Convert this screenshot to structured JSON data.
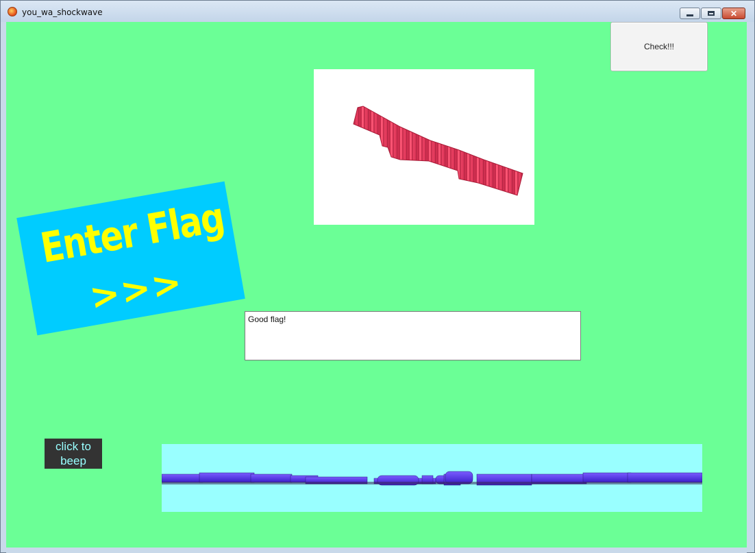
{
  "window": {
    "title": "you_wa_shockwave",
    "controls": {
      "minimize": "minimize",
      "maximize": "maximize",
      "close": "✕"
    }
  },
  "stage": {
    "background": "#6bff96",
    "check_button": {
      "label": "Check!!!"
    },
    "enter_flag_banner": {
      "line1": "Enter Flag",
      "line2": ">>>",
      "bg": "#00ccff",
      "fg": "#ffff00"
    },
    "flag_input": {
      "value": "Good flag!"
    },
    "beep_button": {
      "label_line1": "click to",
      "label_line2": "beep"
    },
    "strip_bg": "#99ffff"
  }
}
